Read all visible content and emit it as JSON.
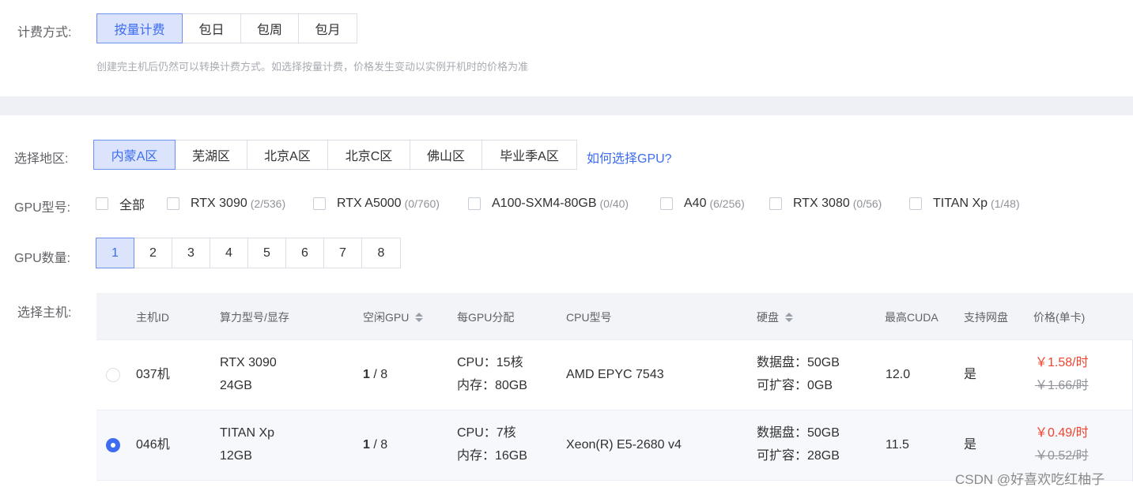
{
  "billing": {
    "label": "计费方式:",
    "options": [
      "按量计费",
      "包日",
      "包周",
      "包月"
    ],
    "selected": "按量计费",
    "hint": "创建完主机后仍然可以转换计费方式。如选择按量计费，价格发生变动以实例开机时的价格为准"
  },
  "region": {
    "label": "选择地区:",
    "options": [
      "内蒙A区",
      "芜湖区",
      "北京A区",
      "北京C区",
      "佛山区",
      "毕业季A区"
    ],
    "selected": "内蒙A区",
    "help_link": "如何选择GPU?"
  },
  "gpu_model": {
    "label": "GPU型号:",
    "items": [
      {
        "name": "全部",
        "count": ""
      },
      {
        "name": "RTX 3090",
        "count": "(2/536)"
      },
      {
        "name": "RTX A5000",
        "count": "(0/760)"
      },
      {
        "name": "A100-SXM4-80GB",
        "count": "(0/40)"
      },
      {
        "name": "A40",
        "count": "(6/256)"
      },
      {
        "name": "RTX 3080",
        "count": "(0/56)"
      },
      {
        "name": "TITAN Xp",
        "count": "(1/48)"
      }
    ]
  },
  "gpu_count": {
    "label": "GPU数量:",
    "options": [
      "1",
      "2",
      "3",
      "4",
      "5",
      "6",
      "7",
      "8"
    ],
    "selected": "1"
  },
  "host": {
    "label": "选择主机:",
    "columns": [
      "主机ID",
      "算力型号/显存",
      "空闲GPU",
      "每GPU分配",
      "CPU型号",
      "硬盘",
      "最高CUDA",
      "支持网盘",
      "价格(单卡)"
    ],
    "rows": [
      {
        "selected": false,
        "id": "037机",
        "model": "RTX 3090",
        "vram": "24GB",
        "free": "1",
        "total": " / 8",
        "cpu_alloc": "CPU：15核",
        "mem_alloc": "内存：80GB",
        "cpu_model": "AMD EPYC 7543",
        "disk_data": "数据盘：50GB",
        "disk_expand": "可扩容：0GB",
        "cuda": "12.0",
        "netdisk": "是",
        "price": "￥1.58/时",
        "price_old": "￥1.66/时"
      },
      {
        "selected": true,
        "id": "046机",
        "model": "TITAN Xp",
        "vram": "12GB",
        "free": "1",
        "total": " / 8",
        "cpu_alloc": "CPU：7核",
        "mem_alloc": "内存：16GB",
        "cpu_model": "Xeon(R) E5-2680 v4",
        "disk_data": "数据盘：50GB",
        "disk_expand": "可扩容：28GB",
        "cuda": "11.5",
        "netdisk": "是",
        "price": "￥0.49/时",
        "price_old": "￥0.52/时"
      }
    ]
  },
  "watermark": "CSDN @好喜欢吃红柚子",
  "colors": {
    "accent": "#3d6cf0",
    "active_bg": "#dbe4fb",
    "price": "#f0442e",
    "band": "#eef0f6"
  }
}
